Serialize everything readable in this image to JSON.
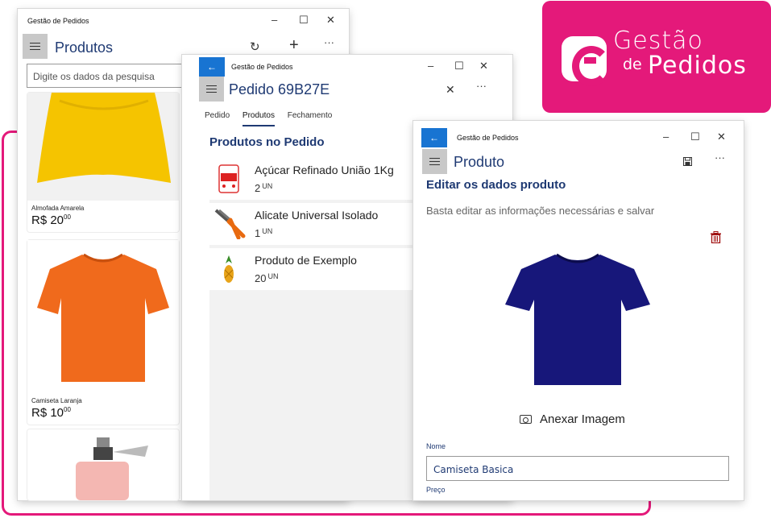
{
  "brand": {
    "line1": "Gestão",
    "line2_small": "de",
    "line2_large": "Pedidos",
    "color": "#e4197a"
  },
  "window_list": {
    "title": "Gestão de Pedidos",
    "header": "Produtos",
    "search_placeholder": "Digite os dados da pesquisa",
    "products": [
      {
        "name": "Almofada Amarela",
        "price": "R$ 20",
        "cents": "00"
      },
      {
        "name": "Camiseta Laranja",
        "price": "R$ 10",
        "cents": "00"
      },
      {
        "name": "",
        "price": "",
        "cents": ""
      }
    ]
  },
  "window_order": {
    "title": "Gestão de Pedidos",
    "header": "Pedido 69B27E",
    "tabs": [
      {
        "label": "Pedido"
      },
      {
        "label": "Produtos"
      },
      {
        "label": "Fechamento"
      }
    ],
    "active_tab": "Produtos",
    "section_title": "Produtos no Pedido",
    "items": [
      {
        "name": "Açúcar Refinado União 1Kg",
        "qty": "2",
        "unit": "UN"
      },
      {
        "name": "Alicate Universal Isolado",
        "qty": "1",
        "unit": "UN"
      },
      {
        "name": "Produto de Exemplo",
        "qty": "20",
        "unit": "UN"
      }
    ]
  },
  "window_product": {
    "title": "Gestão de Pedidos",
    "header": "Produto",
    "section_title": "Editar os dados produto",
    "subtitle": "Basta editar as informações necessárias e salvar",
    "attach_label": "Anexar Imagem",
    "name_label": "Nome",
    "name_value": "Camiseta Basica",
    "price_label": "Preço"
  },
  "window_controls": {
    "minimize": "–",
    "maximize": "☐",
    "close": "✕",
    "more": "···",
    "back": "←",
    "refresh": "↻",
    "add": "+"
  },
  "colors": {
    "accent": "#1f3a73",
    "back_button": "#1874d2",
    "brand": "#e4197a"
  }
}
